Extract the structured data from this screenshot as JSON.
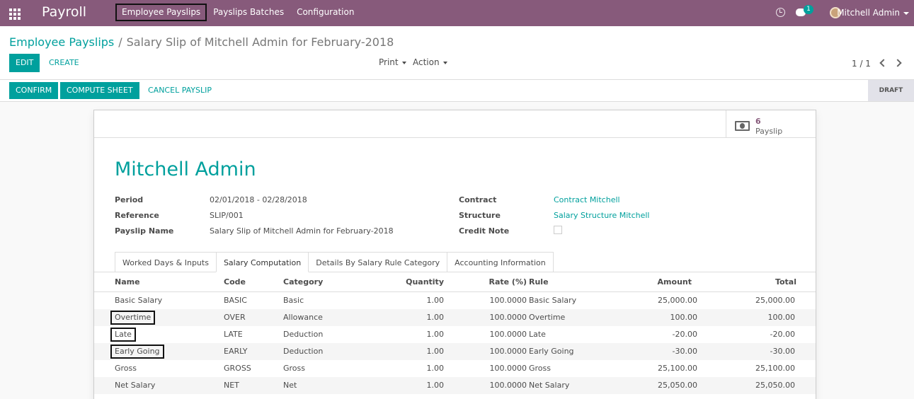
{
  "app": {
    "title": "Payroll",
    "menu": [
      "Employee Payslips",
      "Payslips Batches",
      "Configuration"
    ],
    "chat_count": "1",
    "user_name": "Mitchell Admin"
  },
  "breadcrumb": {
    "parent": "Employee Payslips",
    "separator": "/",
    "current": "Salary Slip of Mitchell Admin for February-2018"
  },
  "toolbar": {
    "edit": "EDIT",
    "create": "CREATE",
    "print": "Print",
    "action": "Action",
    "pager": "1 / 1"
  },
  "statusbar": {
    "confirm": "CONFIRM",
    "compute": "COMPUTE SHEET",
    "cancel": "CANCEL PAYSLIP",
    "status": "DRAFT"
  },
  "stat": {
    "value": "6",
    "label": "Payslip"
  },
  "form": {
    "employee": "Mitchell Admin",
    "period_label": "Period",
    "period_value": "02/01/2018 - 02/28/2018",
    "reference_label": "Reference",
    "reference_value": "SLIP/001",
    "payslip_name_label": "Payslip Name",
    "payslip_name_value": "Salary Slip of Mitchell Admin for February-2018",
    "contract_label": "Contract",
    "contract_value": "Contract Mitchell",
    "structure_label": "Structure",
    "structure_value": "Salary Structure Mitchell",
    "credit_note_label": "Credit Note",
    "credit_note_checked": false
  },
  "tabs": [
    "Worked Days & Inputs",
    "Salary Computation",
    "Details By Salary Rule Category",
    "Accounting Information"
  ],
  "table": {
    "headers": [
      "Name",
      "Code",
      "Category",
      "Quantity",
      "Rate (%)",
      "Rule",
      "Amount",
      "Total"
    ],
    "rows": [
      [
        "Basic Salary",
        "BASIC",
        "Basic",
        "1.00",
        "100.0000",
        "Basic Salary",
        "25,000.00",
        "25,000.00"
      ],
      [
        "Overtime",
        "OVER",
        "Allowance",
        "1.00",
        "100.0000",
        "Overtime",
        "100.00",
        "100.00"
      ],
      [
        "Late",
        "LATE",
        "Deduction",
        "1.00",
        "100.0000",
        "Late",
        "-20.00",
        "-20.00"
      ],
      [
        "Early Going",
        "EARLY",
        "Deduction",
        "1.00",
        "100.0000",
        "Early Going",
        "-30.00",
        "-30.00"
      ],
      [
        "Gross",
        "GROSS",
        "Gross",
        "1.00",
        "100.0000",
        "Gross",
        "25,100.00",
        "25,100.00"
      ],
      [
        "Net Salary",
        "NET",
        "Net",
        "1.00",
        "100.0000",
        "Net Salary",
        "25,050.00",
        "25,050.00"
      ]
    ]
  }
}
